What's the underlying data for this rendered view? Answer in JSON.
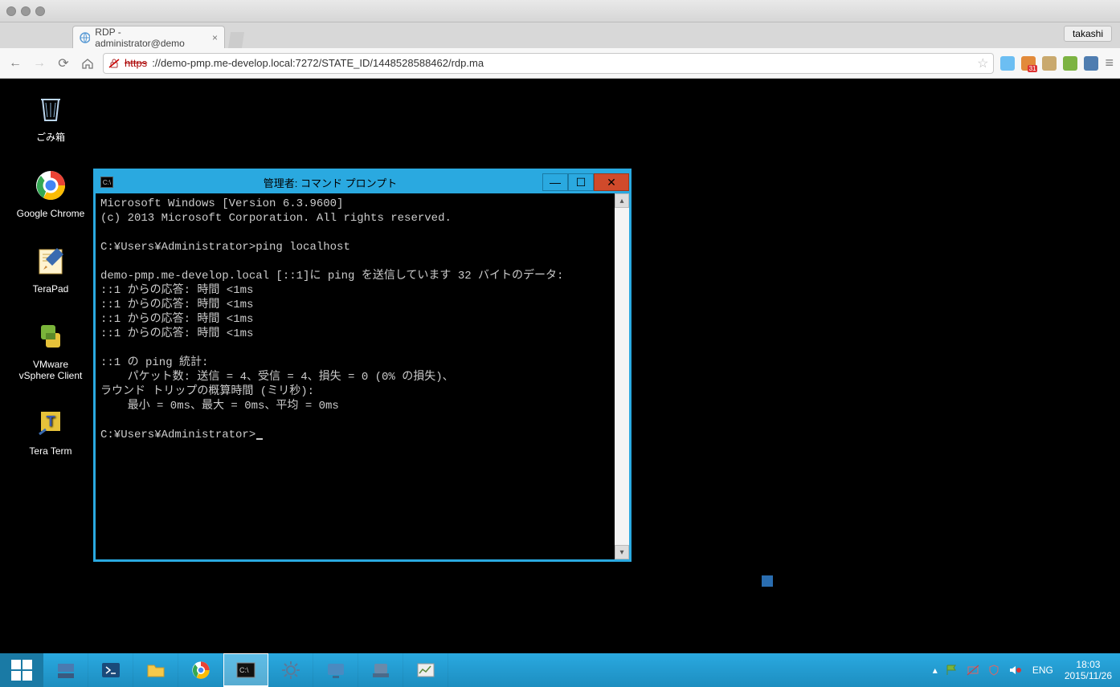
{
  "host": {
    "tab_title": "RDP - administrator@demo",
    "user_button": "takashi",
    "url_https": "https",
    "url_rest": "://demo-pmp.me-develop.local:7272/STATE_ID/1448528588462/rdp.ma"
  },
  "desktop": {
    "icons": [
      "ごみ箱",
      "Google Chrome",
      "TeraPad",
      "VMware vSphere Client",
      "Tera Term"
    ]
  },
  "cmd": {
    "title": "管理者: コマンド プロンプト",
    "lines": [
      "Microsoft Windows [Version 6.3.9600]",
      "(c) 2013 Microsoft Corporation. All rights reserved.",
      "",
      "C:¥Users¥Administrator>ping localhost",
      "",
      "demo-pmp.me-develop.local [::1]に ping を送信しています 32 バイトのデータ:",
      "::1 からの応答: 時間 <1ms",
      "::1 からの応答: 時間 <1ms",
      "::1 からの応答: 時間 <1ms",
      "::1 からの応答: 時間 <1ms",
      "",
      "::1 の ping 統計:",
      "    パケット数: 送信 = 4、受信 = 4、損失 = 0 (0% の損失)、",
      "ラウンド トリップの概算時間 (ミリ秒):",
      "    最小 = 0ms、最大 = 0ms、平均 = 0ms",
      "",
      "C:¥Users¥Administrator>"
    ]
  },
  "tray": {
    "lang": "ENG",
    "time": "18:03",
    "date": "2015/11/26"
  }
}
